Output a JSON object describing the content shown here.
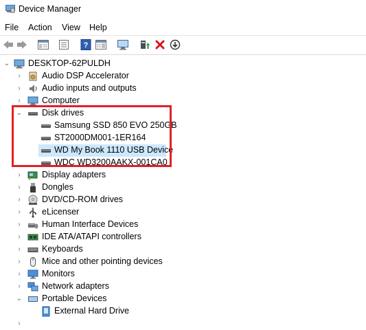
{
  "window": {
    "title": "Device Manager"
  },
  "menu": [
    "File",
    "Action",
    "View",
    "Help"
  ],
  "toolbar": {
    "icons": [
      "back-icon",
      "forward-icon",
      "show-hide-console-tree-icon",
      "properties-icon",
      "help-icon",
      "action-pane-icon",
      "scan-hardware-icon",
      "update-driver-icon",
      "uninstall-device-icon",
      "disable-device-icon"
    ]
  },
  "tree": {
    "root": "DESKTOP-62PULDH",
    "categories": [
      {
        "label": "Audio DSP Accelerator",
        "icon": "audio-dsp-icon"
      },
      {
        "label": "Audio inputs and outputs",
        "icon": "speaker-icon"
      },
      {
        "label": "Computer",
        "icon": "computer-icon"
      },
      {
        "label": "Disk drives",
        "icon": "disk-drive-icon",
        "expanded": true,
        "children": [
          "Samsung SSD 850 EVO 250GB",
          "ST2000DM001-1ER164",
          "WD My Book 1110 USB Device",
          "WDC WD3200AAKX-001CA0"
        ]
      },
      {
        "label": "Display adapters",
        "icon": "display-adapter-icon"
      },
      {
        "label": "Dongles",
        "icon": "dongle-icon"
      },
      {
        "label": "DVD/CD-ROM drives",
        "icon": "dvd-drive-icon"
      },
      {
        "label": "eLicenser",
        "icon": "usb-icon"
      },
      {
        "label": "Human Interface Devices",
        "icon": "hid-icon"
      },
      {
        "label": "IDE ATA/ATAPI controllers",
        "icon": "ide-controller-icon"
      },
      {
        "label": "Keyboards",
        "icon": "keyboard-icon"
      },
      {
        "label": "Mice and other pointing devices",
        "icon": "mouse-icon"
      },
      {
        "label": "Monitors",
        "icon": "monitor-icon"
      },
      {
        "label": "Network adapters",
        "icon": "network-adapter-icon"
      },
      {
        "label": "Portable Devices",
        "icon": "portable-device-icon",
        "expanded": true,
        "children": [
          "External Hard Drive"
        ]
      }
    ],
    "selected": "WD My Book 1110 USB Device"
  },
  "colors": {
    "selection": "#cce8ff",
    "highlight_box": "#e11f26"
  }
}
